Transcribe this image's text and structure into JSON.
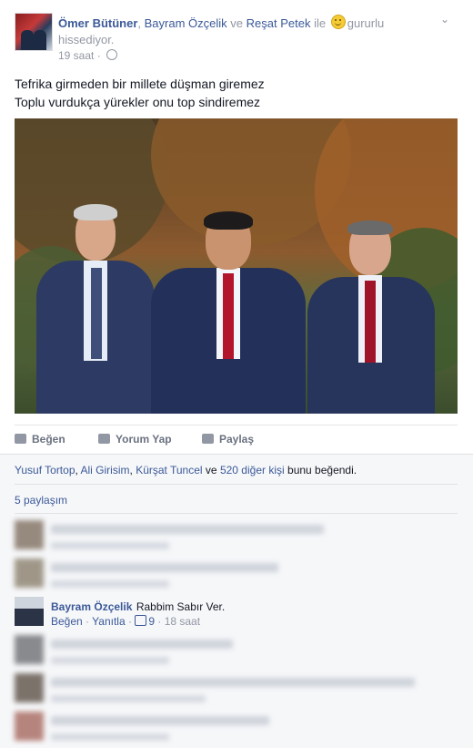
{
  "post": {
    "author": "Ömer Bütüner",
    "tagged_1": "Bayram Özçelik",
    "connector_ve": "ve",
    "tagged_2": "Reşat Petek",
    "connector_ile": "ile",
    "feeling": "gururlu hissediyor.",
    "time": "19 saat",
    "dot": "·",
    "text_line1": "Tefrika girmeden bir millete düşman giremez",
    "text_line2": "Toplu vurdukça yürekler onu top sindiremez"
  },
  "actions": {
    "like": "Beğen",
    "comment": "Yorum Yap",
    "share": "Paylaş"
  },
  "likes": {
    "names": [
      "Yusuf Tortop",
      "Ali Girisim",
      "Kürşat Tuncel"
    ],
    "sep": ",",
    "and": "ve",
    "others": "520 diğer kişi",
    "suffix": "bunu beğendi."
  },
  "shares": "5 paylaşım",
  "comments": [
    {
      "name": "Bayram Özçelik",
      "text": "Rabbim Sabır Ver.",
      "like": "Beğen",
      "reply": "Yanıtla",
      "likes": "9",
      "time": "18 saat"
    }
  ],
  "colors": {
    "link": "#3b5998",
    "muted": "#9197a3",
    "panel": "#f6f7f9"
  }
}
